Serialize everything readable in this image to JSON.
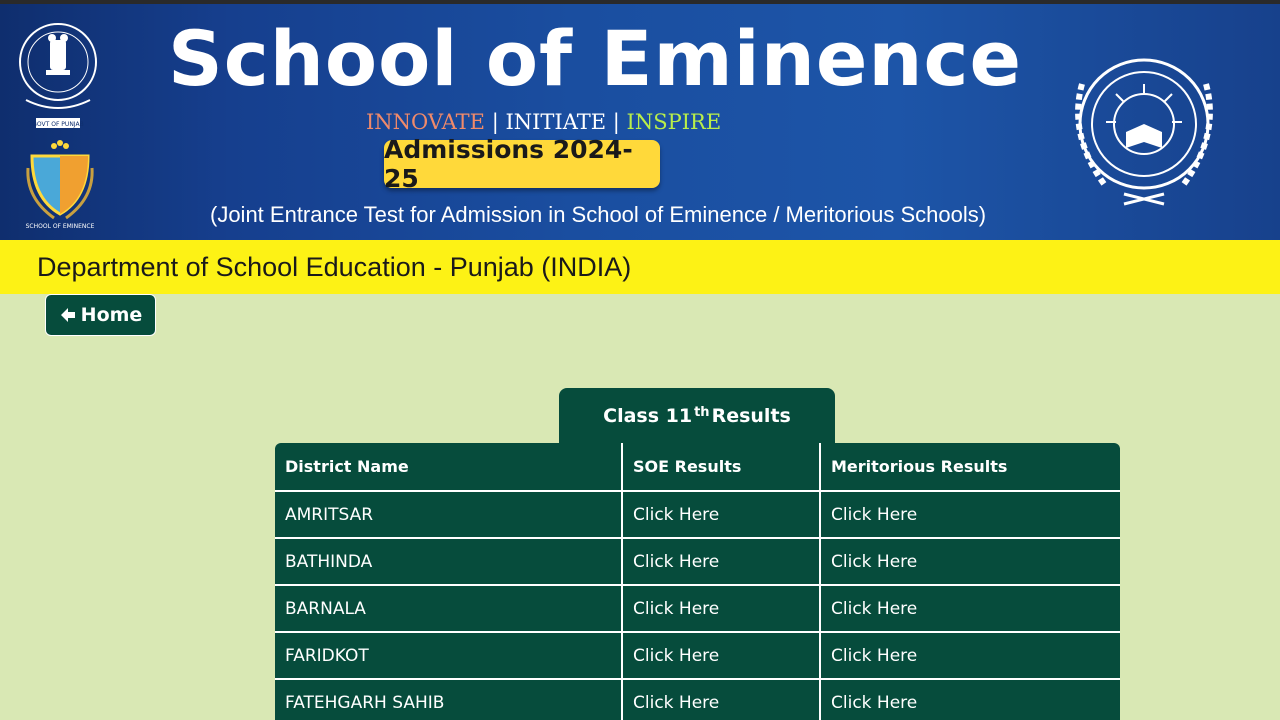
{
  "banner": {
    "title": "School of Eminence",
    "tagline": {
      "innovate": "INNOVATE",
      "initiate": "INITIATE",
      "inspire": "INSPIRE",
      "separator": "|"
    },
    "admission_label": "Admissions 2024-25",
    "subtitle": "(Joint Entrance Test for Admission in School of Eminence / Meritorious Schools)",
    "emblem_caption": "GOVT OF PUNJAB",
    "soe_logo_caption": "SCHOOL OF EMINENCE",
    "seal_icon": "pseb-seal-icon"
  },
  "department": "Department of School Education - Punjab (INDIA)",
  "nav": {
    "home_label": "Home",
    "home_icon": "arrow-left-icon"
  },
  "results": {
    "tab_prefix": "Class 11",
    "tab_sup": "th",
    "tab_suffix": "Results",
    "headers": {
      "district": "District Name",
      "soe": "SOE Results",
      "merit": "Meritorious Results"
    },
    "rows": [
      {
        "district": "AMRITSAR",
        "soe": "Click Here",
        "merit": "Click Here"
      },
      {
        "district": "BATHINDA",
        "soe": "Click Here",
        "merit": "Click Here"
      },
      {
        "district": "BARNALA",
        "soe": "Click Here",
        "merit": "Click Here"
      },
      {
        "district": "FARIDKOT",
        "soe": "Click Here",
        "merit": "Click Here"
      },
      {
        "district": "FATEHGARH SAHIB",
        "soe": "Click Here",
        "merit": "Click Here"
      }
    ]
  },
  "colors": {
    "banner_blue": "#1a4ea0",
    "dept_yellow": "#fdf215",
    "admission_yellow": "#ffd93a",
    "primary_green": "#064c3c",
    "page_bg": "#d9e8b4"
  }
}
